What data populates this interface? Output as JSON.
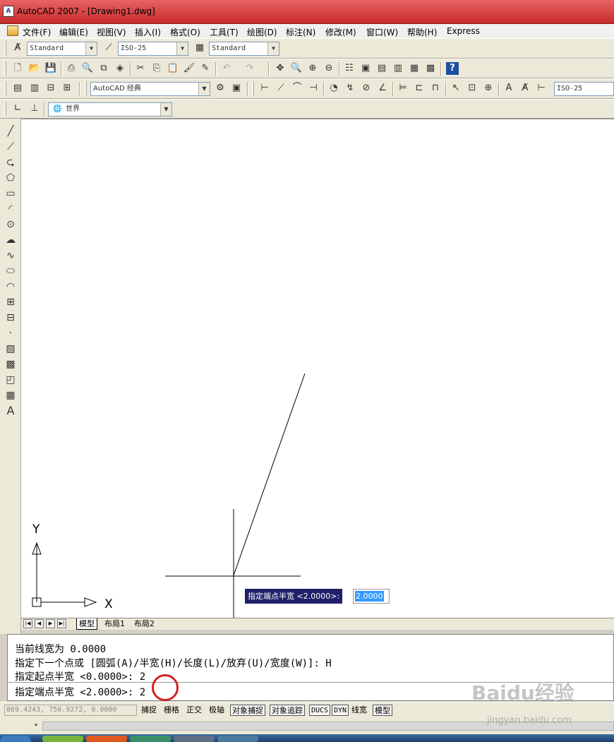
{
  "window": {
    "title": "AutoCAD 2007 - [Drawing1.dwg]"
  },
  "menu": [
    "文件(F)",
    "编辑(E)",
    "视图(V)",
    "插入(I)",
    "格式(O)",
    "工具(T)",
    "绘图(D)",
    "标注(N)",
    "修改(M)",
    "窗口(W)",
    "帮助(H)",
    "Express"
  ],
  "styles_toolbar": {
    "text_style": "Standard",
    "dim_style": "ISO-25",
    "table_style": "Standard"
  },
  "workspaces_toolbar": {
    "workspace": "AutoCAD 经典"
  },
  "dims_toolbar": {
    "dim_style": "ISO-25"
  },
  "ucs_toolbar": {
    "ucs": "世界"
  },
  "canvas": {
    "ucs_y_label": "Y",
    "ucs_x_label": "X"
  },
  "dynamic_input": {
    "prompt": "指定端点半宽 <2.0000>:",
    "value": "2.0000"
  },
  "layout_tabs": [
    "模型",
    "布局1",
    "布局2"
  ],
  "command_window": {
    "lines": [
      "当前线宽为 0.0000",
      "指定下一个点或 [圆弧(A)/半宽(H)/长度(L)/放弃(U)/宽度(W)]: H",
      "指定起点半宽 <0.0000>: 2"
    ],
    "current": "指定端点半宽 <2.0000>: 2"
  },
  "statusbar": {
    "coords": "869.4243, 756.9272, 0.0000",
    "buttons": [
      "捕捉",
      "栅格",
      "正交",
      "极轴",
      "对象捕捉",
      "对象追踪",
      "DUCS",
      "DYN",
      "线宽",
      "模型"
    ],
    "on_buttons": [
      "对象捕捉",
      "对象追踪",
      "DUCS",
      "DYN",
      "模型"
    ]
  },
  "watermark": {
    "brand": "Baidu经验",
    "url": "jingyan.baidu.com"
  },
  "colors": {
    "titlebar": "#d04848",
    "dyn_prompt_bg": "#20206a",
    "selection": "#3399ff",
    "annotation": "#d42020"
  }
}
